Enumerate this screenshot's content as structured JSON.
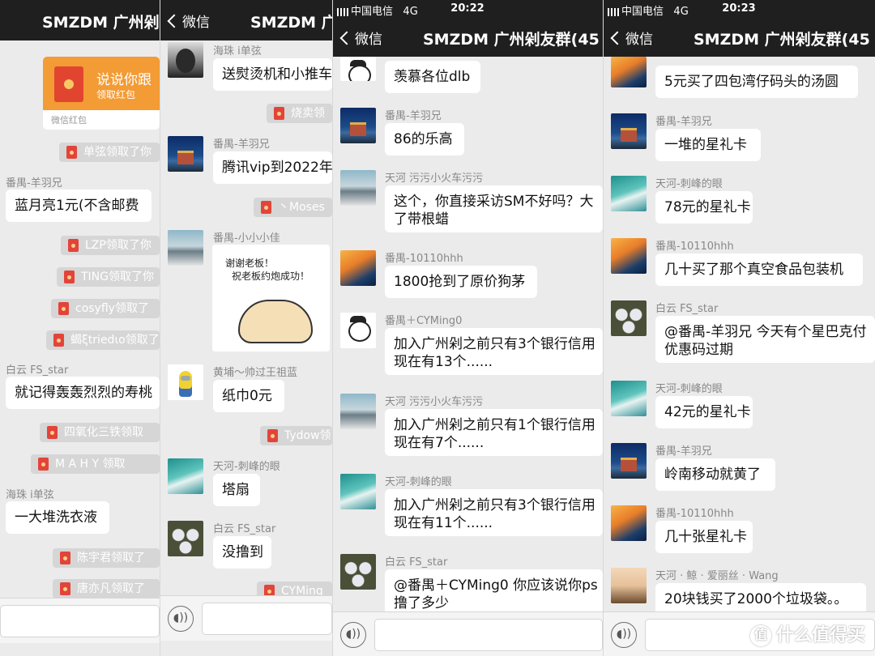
{
  "common": {
    "back_label": "微信",
    "group_title": "SMZDM 广州剁友群(45",
    "carrier": "中国电信",
    "network": "4G",
    "short_title_p1": "SMZDM 广州剁",
    "short_title_p2": "SMZDM 广"
  },
  "panel1": {
    "red_packet": {
      "title": "说说你跟",
      "subtitle": "领取红包",
      "source": "微信红包"
    },
    "sys": [
      "单弦领取了你",
      "LZP领取了你",
      "TING领取了你",
      "cosyfly领取了",
      "蝎ξtriedιο领取了",
      "四氧化三铁领取",
      "M A H Y 领取",
      "陈宇君领取了",
      "唐亦凡领取了"
    ],
    "messages": [
      {
        "sender": "番禺-羊羽兄",
        "text": "蓝月亮1元(不含邮费"
      },
      {
        "sender": "白云 FS_star",
        "text": "就记得轰轰烈烈的寿桃"
      },
      {
        "sender": "海珠 i单弦",
        "text": "一大堆洗衣液"
      }
    ]
  },
  "panel2": {
    "sys": [
      "烧卖领",
      "丶Moses",
      "Tydow领",
      "CYMing"
    ],
    "messages": [
      {
        "sender": "海珠 i单弦",
        "text": "送熨烫机和小推车"
      },
      {
        "sender": "番禺-羊羽兄",
        "text": "腾讯vip到2022年"
      },
      {
        "sender": "番禺-小小小佳",
        "text": ""
      },
      {
        "sender": "黄埔～帅过王祖蓝",
        "text": "纸巾0元"
      },
      {
        "sender": "天河-刺峰的眼",
        "text": "塔扇"
      },
      {
        "sender": "白云 FS_star",
        "text": "没撸到"
      }
    ],
    "sticker": {
      "line1": "谢谢老板！",
      "line2": "祝老板约炮成功！"
    }
  },
  "panel3": {
    "time": "20:22",
    "messages": [
      {
        "sender": "",
        "text": "羡慕各位dlb"
      },
      {
        "sender": "番禺-羊羽兄",
        "text": "86的乐高"
      },
      {
        "sender": "天河 污污小火车污污",
        "text": "这个，你直接采访SM不好吗？大",
        "text2": "了带根蜡"
      },
      {
        "sender": "番禺-10110hhh",
        "text": "1800抢到了原价狗茅"
      },
      {
        "sender": "番禺＋CYMing0",
        "text": "加入广州剁之前只有3个银行信用",
        "text2": "现在有13个......"
      },
      {
        "sender": "天河 污污小火车污污",
        "text": "加入广州剁之前只有1个银行信用",
        "text2": "现在有7个......"
      },
      {
        "sender": "天河-刺峰的眼",
        "text": "加入广州剁之前只有3个银行信用",
        "text2": "现在有11个......"
      },
      {
        "sender": "白云 FS_star",
        "text": "@番禺＋CYMing0 你应该说你ps",
        "text2": "撸了多少"
      }
    ]
  },
  "panel4": {
    "time": "20:23",
    "messages": [
      {
        "sender": "番禺-10110hhh",
        "text": "5元买了四包湾仔码头的汤圆"
      },
      {
        "sender": "番禺-羊羽兄",
        "text": "一堆的星礼卡"
      },
      {
        "sender": "天河-刺峰的眼",
        "text": "78元的星礼卡"
      },
      {
        "sender": "番禺-10110hhh",
        "text": "几十买了那个真空食品包装机"
      },
      {
        "sender": "白云 FS_star",
        "text": "@番禺-羊羽兄 今天有个星巴克付",
        "text2": "优惠码过期"
      },
      {
        "sender": "天河-刺峰的眼",
        "text": "42元的星礼卡"
      },
      {
        "sender": "番禺-羊羽兄",
        "text": "岭南移动就黄了"
      },
      {
        "sender": "番禺-10110hhh",
        "text": "几十张星礼卡"
      },
      {
        "sender": "天河 · 鲸 · 爱丽丝 · Wang",
        "text": "20块钱买了2000个垃圾袋。。"
      }
    ]
  },
  "watermark": {
    "text": "什么值得买",
    "icon": "值"
  }
}
